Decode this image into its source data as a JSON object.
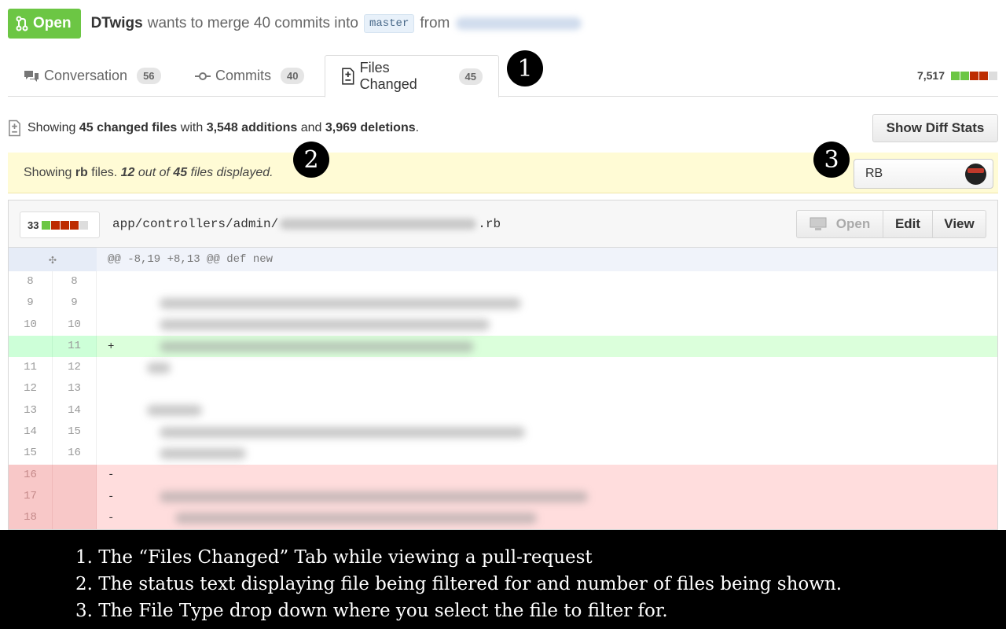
{
  "pr": {
    "state": "Open",
    "author": "DTwigs",
    "merge_text": "wants to merge 40 commits into",
    "base_branch": "master",
    "from_text": "from"
  },
  "tabs": [
    {
      "label": "Conversation",
      "count": "56",
      "icon": "comment-discussion-icon"
    },
    {
      "label": "Commits",
      "count": "40",
      "icon": "git-commit-icon"
    },
    {
      "label": "Files Changed",
      "count": "45",
      "icon": "file-diff-icon",
      "selected": true
    }
  ],
  "total_changes": "7,517",
  "callouts": [
    "1",
    "2",
    "3"
  ],
  "summary": {
    "prefix": "Showing",
    "files": "45 changed files",
    "with": "with",
    "additions": "3,548 additions",
    "and": "and",
    "deletions": "3,969 deletions",
    "end": "."
  },
  "show_diff_stats_label": "Show Diff Stats",
  "filter": {
    "showing": "Showing",
    "type": "rb",
    "files_word": "files.",
    "shown": "12",
    "out_of": "out of",
    "total": "45",
    "displayed": "files displayed.",
    "selected_value": "RB"
  },
  "file": {
    "changes": "33",
    "path_prefix": "app/controllers/admin/",
    "path_suffix": ".rb",
    "actions": {
      "open": "Open",
      "edit": "Edit",
      "view": "View"
    },
    "hunk": "@@ -8,19 +8,13 @@ def new",
    "lines": [
      {
        "old": "8",
        "new": "8",
        "type": "ctx",
        "sign": "",
        "blur_w": 0,
        "indent": 0
      },
      {
        "old": "9",
        "new": "9",
        "type": "ctx",
        "sign": "",
        "blur_w": 460,
        "indent": 30
      },
      {
        "old": "10",
        "new": "10",
        "type": "ctx",
        "sign": "",
        "blur_w": 420,
        "indent": 30
      },
      {
        "old": "",
        "new": "11",
        "type": "add",
        "sign": "+",
        "blur_w": 400,
        "indent": 30
      },
      {
        "old": "11",
        "new": "12",
        "type": "ctx",
        "sign": "",
        "blur_w": 30,
        "indent": 14
      },
      {
        "old": "12",
        "new": "13",
        "type": "ctx",
        "sign": "",
        "blur_w": 0,
        "indent": 0
      },
      {
        "old": "13",
        "new": "14",
        "type": "ctx",
        "sign": "",
        "blur_w": 70,
        "indent": 14
      },
      {
        "old": "14",
        "new": "15",
        "type": "ctx",
        "sign": "",
        "blur_w": 465,
        "indent": 30
      },
      {
        "old": "15",
        "new": "16",
        "type": "ctx",
        "sign": "",
        "blur_w": 110,
        "indent": 30
      },
      {
        "old": "16",
        "new": "",
        "type": "del",
        "sign": "-",
        "blur_w": 0,
        "indent": 0
      },
      {
        "old": "17",
        "new": "",
        "type": "del",
        "sign": "-",
        "blur_w": 545,
        "indent": 30
      },
      {
        "old": "18",
        "new": "",
        "type": "del",
        "sign": "-",
        "blur_w": 460,
        "indent": 50
      }
    ]
  },
  "caption": [
    "1. The “Files Changed” Tab while viewing a pull-request",
    "2. The status text displaying file being filtered for and number of files being shown.",
    "3. The File Type drop down where you select the file to filter for."
  ]
}
